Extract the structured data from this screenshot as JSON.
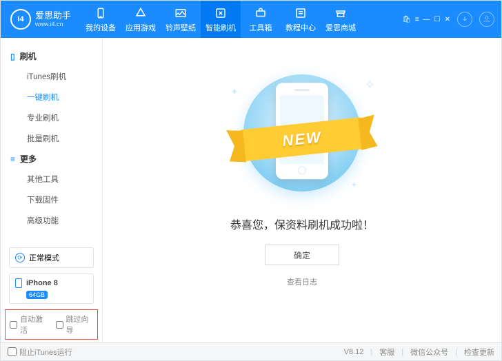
{
  "brand": {
    "name": "爱思助手",
    "url": "www.i4.cn",
    "mark": "i4"
  },
  "headerNav": [
    {
      "key": "device",
      "label": "我的设备"
    },
    {
      "key": "apps",
      "label": "应用游戏"
    },
    {
      "key": "ring",
      "label": "铃声壁纸"
    },
    {
      "key": "flash",
      "label": "智能刷机"
    },
    {
      "key": "toolbox",
      "label": "工具箱"
    },
    {
      "key": "tutorial",
      "label": "教程中心"
    },
    {
      "key": "store",
      "label": "爱思商城"
    }
  ],
  "headerActiveKey": "flash",
  "sidebar": {
    "secA": {
      "title": "刷机",
      "items": [
        {
          "key": "itunes",
          "label": "iTunes刷机"
        },
        {
          "key": "oneclick",
          "label": "一键刷机"
        },
        {
          "key": "pro",
          "label": "专业刷机"
        },
        {
          "key": "batch",
          "label": "批量刷机"
        }
      ],
      "selectedKey": "oneclick"
    },
    "secB": {
      "title": "更多",
      "items": [
        {
          "key": "other",
          "label": "其他工具"
        },
        {
          "key": "download",
          "label": "下载固件"
        },
        {
          "key": "advanced",
          "label": "高级功能"
        }
      ]
    },
    "modeBox": "正常模式",
    "device": {
      "name": "iPhone 8",
      "storage": "64GB"
    },
    "opts": {
      "autoActivate": "自动激活",
      "skipWizard": "跳过向导"
    }
  },
  "main": {
    "ribbonText": "NEW",
    "message": "恭喜您，保资料刷机成功啦！",
    "okBtn": "确定",
    "viewLog": "查看日志"
  },
  "footer": {
    "preventItunes": "阻止iTunes运行",
    "version": "V8.12",
    "links": [
      "客服",
      "微信公众号",
      "检查更新"
    ]
  }
}
